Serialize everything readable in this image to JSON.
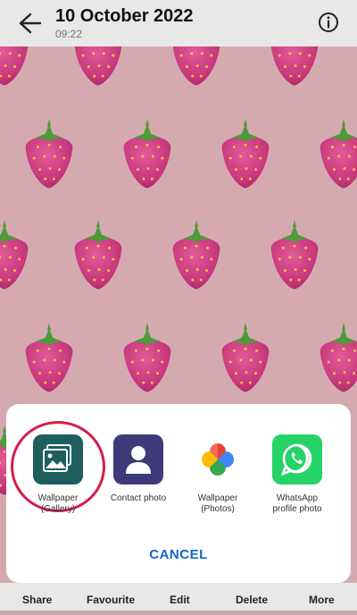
{
  "header": {
    "title": "10 October 2022",
    "time": "09:22"
  },
  "share_sheet": {
    "options": [
      {
        "label": "Wallpaper\n(Gallery)",
        "icon": "gallery-wallpaper-icon"
      },
      {
        "label": "Contact photo",
        "icon": "contact-person-icon"
      },
      {
        "label": "Wallpaper\n(Photos)",
        "icon": "google-photos-pinwheel-icon"
      },
      {
        "label": "WhatsApp\nprofile photo",
        "icon": "whatsapp-icon"
      }
    ],
    "cancel_label": "CANCEL"
  },
  "bottom_nav": {
    "share": "Share",
    "favourite": "Favourite",
    "edit": "Edit",
    "delete": "Delete",
    "more": "More"
  },
  "colors": {
    "photo_background": "#d4aab0",
    "highlight_ring": "#d81b4a",
    "cancel_text": "#1565c0",
    "gallery_icon_bg": "#1d5e5e",
    "contact_icon_bg": "#3e3a7a",
    "whatsapp_green": "#25d366"
  }
}
